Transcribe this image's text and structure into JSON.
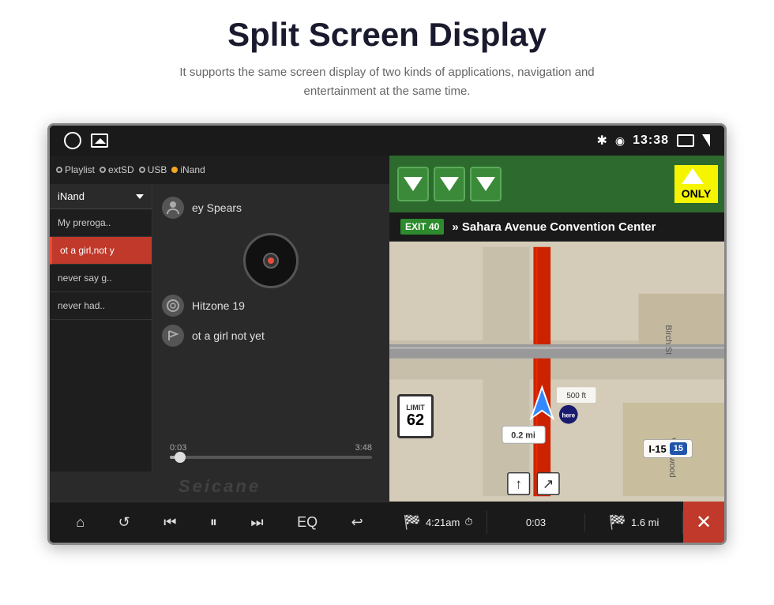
{
  "header": {
    "title": "Split Screen Display",
    "subtitle": "It supports the same screen display of two kinds of applications,\nnavigation and entertainment at the same time."
  },
  "status_bar": {
    "time": "13:38",
    "bluetooth": "✱",
    "location": "◉"
  },
  "music_player": {
    "source_tabs": [
      "Playlist",
      "extSD",
      "USB",
      "iNand"
    ],
    "source_selector": "iNand",
    "playlist": [
      {
        "label": "My preroga..",
        "active": false
      },
      {
        "label": "ot a girl,not y",
        "active": true
      },
      {
        "label": "never say g..",
        "active": false
      },
      {
        "label": "never had..",
        "active": false
      }
    ],
    "artist": "ey Spears",
    "album": "Hitzone 19",
    "track": "ot a girl not yet",
    "progress_current": "0:03",
    "progress_total": "3:48",
    "watermark": "Seicane"
  },
  "controls": {
    "home": "⌂",
    "repeat": "↺",
    "prev": "⏮",
    "play_pause": "⏸",
    "next": "⏭",
    "eq": "EQ",
    "back": "↩"
  },
  "navigation": {
    "exit_number": "EXIT 40",
    "exit_text": "» Sahara Avenue Convention Center",
    "only_label": "ONLY",
    "street": "Sahara Avenue",
    "speed_limit": "62",
    "highway": "I-15",
    "highway_shield": "15",
    "distance_turn": "0.2 mi",
    "distance_turn2": "500 ft",
    "eta": "4:21am",
    "elapsed": "0:03",
    "remaining": "1.6 mi",
    "road_label": "Birch St",
    "road_label2": "Westwood"
  }
}
